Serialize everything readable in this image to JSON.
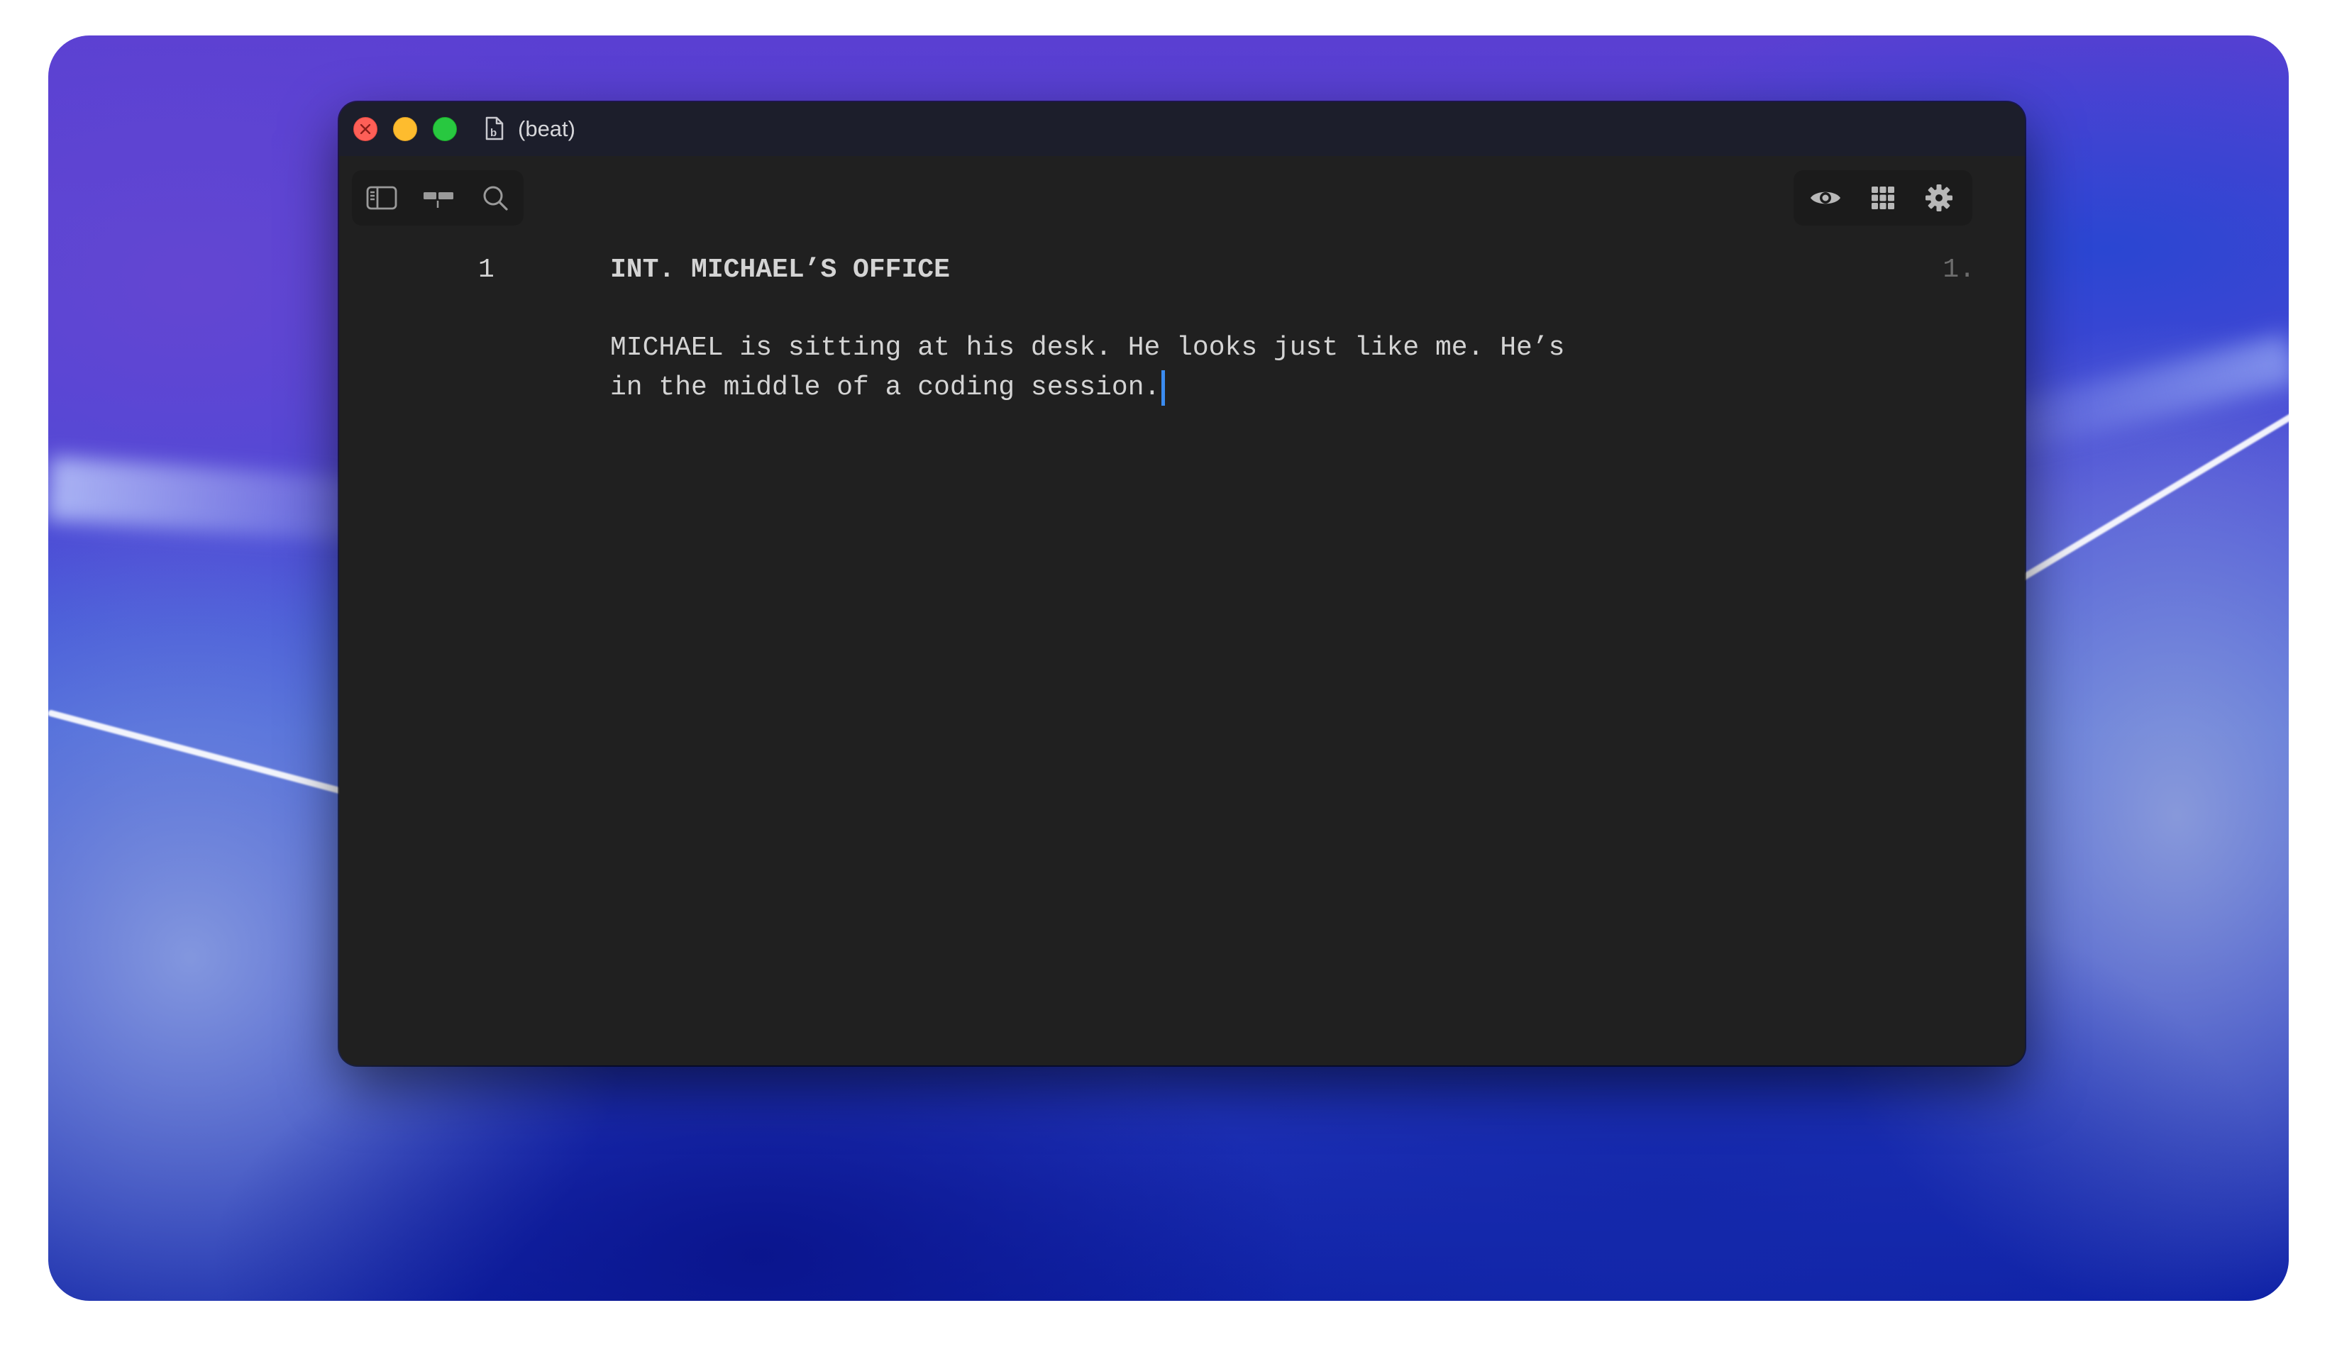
{
  "window": {
    "title": "(beat)"
  },
  "toolbar": {
    "left_icons": [
      "sidebar-icon",
      "timeline-icon",
      "search-icon"
    ],
    "right_icons": [
      "eye-icon",
      "grid-icon",
      "gear-icon"
    ]
  },
  "editor": {
    "scene_number": "1",
    "page_number": "1.",
    "scene_heading": "INT. MICHAEL’S OFFICE",
    "action_lines": [
      "MICHAEL is sitting at his desk. He looks just like me. He’s",
      "in the middle of a coding session."
    ]
  },
  "colors": {
    "editor_background": "#202020",
    "titlebar_background": "#1c1e2b",
    "text": "#d4d4d4",
    "muted_text": "#6d6d6d",
    "caret": "#3b8cf0",
    "close_button": "#fe5f57",
    "minimize_button": "#febc2e",
    "maximize_button": "#28c840"
  }
}
